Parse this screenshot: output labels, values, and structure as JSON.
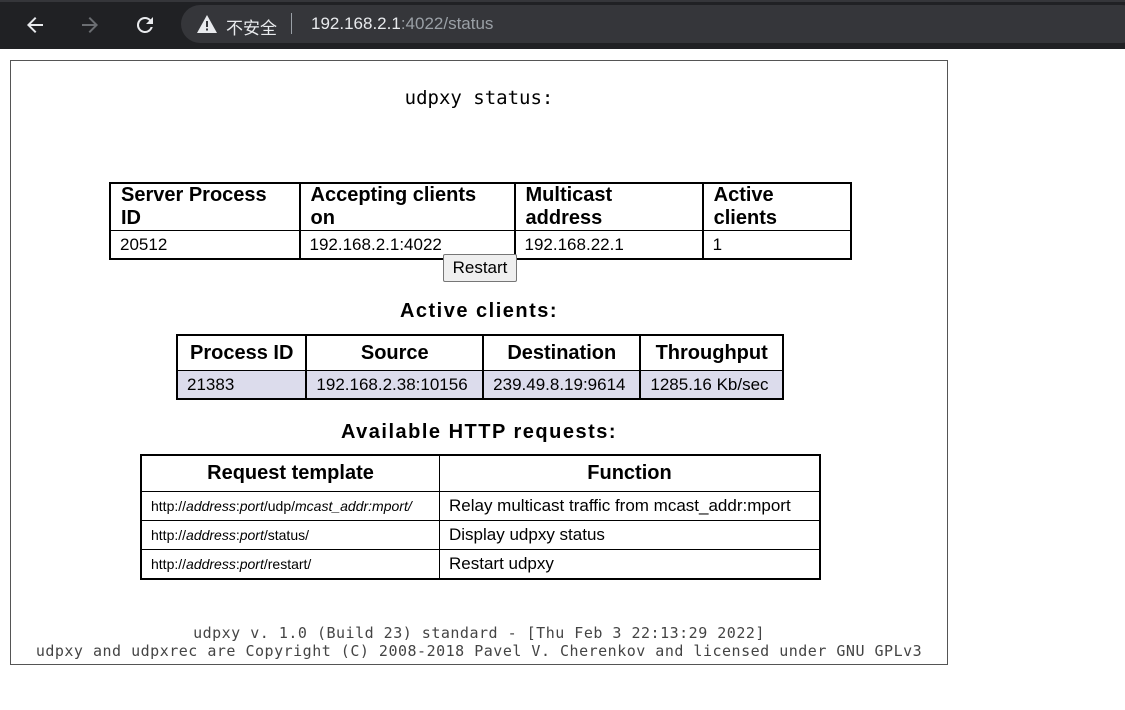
{
  "browser": {
    "security_label": "不安全",
    "url_host": "192.168.2.1",
    "url_path": ":4022/status"
  },
  "page": {
    "title": "udpxy status:",
    "server_table": {
      "headers": [
        "Server Process ID",
        "Accepting clients on",
        "Multicast address",
        "Active clients"
      ],
      "row": [
        "20512",
        "192.168.2.1:4022",
        "192.168.22.1",
        "1"
      ]
    },
    "restart_button": "Restart",
    "clients_heading": "Active clients:",
    "clients_table": {
      "headers": [
        "Process ID",
        "Source",
        "Destination",
        "Throughput"
      ],
      "rows": [
        [
          "21383",
          "192.168.2.38:10156",
          "239.49.8.19:9614",
          "1285.16 Kb/sec"
        ]
      ]
    },
    "requests_heading": "Available HTTP requests:",
    "requests_table": {
      "headers": [
        "Request template",
        "Function"
      ],
      "rows": [
        {
          "prefix": "http://",
          "addr": "address",
          "sep": ":",
          "port": "port",
          "path1": "/udp/",
          "extra": "mcast_addr",
          "sep2": ":",
          "extra2": "mport",
          "tail": "/",
          "function": "Relay multicast traffic from mcast_addr:mport"
        },
        {
          "prefix": "http://",
          "addr": "address",
          "sep": ":",
          "port": "port",
          "path1": "/status/",
          "function": "Display udpxy status"
        },
        {
          "prefix": "http://",
          "addr": "address",
          "sep": ":",
          "port": "port",
          "path1": "/restart/",
          "function": "Restart udpxy"
        }
      ]
    },
    "footer_line1": "udpxy v. 1.0 (Build 23) standard - [Thu Feb 3 22:13:29 2022]",
    "footer_line2": "udpxy and udpxrec are Copyright (C) 2008-2018 Pavel V. Cherenkov and licensed under GNU GPLv3"
  }
}
